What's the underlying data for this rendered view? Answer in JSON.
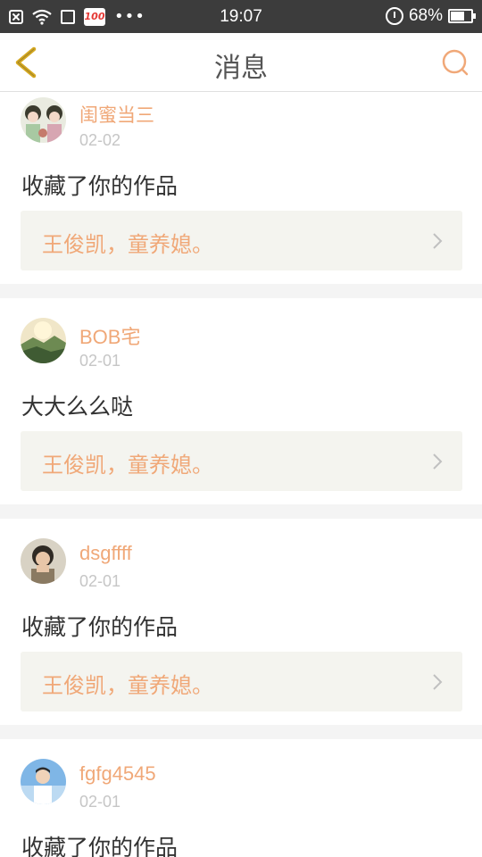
{
  "status_bar": {
    "time": "19:07",
    "battery_text": "68%",
    "battery_level": 0.68,
    "badge_text": "100",
    "more_dots": "•••"
  },
  "nav": {
    "title": "消息"
  },
  "messages": [
    {
      "username": "闺蜜当三",
      "date": "02-02",
      "content": "收藏了你的作品",
      "work_title": "王俊凯，童养媳。"
    },
    {
      "username": "BOB宅",
      "date": "02-01",
      "content": "大大么么哒",
      "work_title": "王俊凯，童养媳。"
    },
    {
      "username": "dsgffff",
      "date": "02-01",
      "content": "收藏了你的作品",
      "work_title": "王俊凯，童养媳。"
    },
    {
      "username": "fgfg4545",
      "date": "02-01",
      "content": "收藏了你的作品",
      "work_title": ""
    }
  ],
  "colors": {
    "accent": "#f0a878",
    "nav_back": "#d4a820",
    "status_bar_bg": "#3c3c3c"
  },
  "icons": {
    "back": "chevron-left-icon",
    "search": "search-icon",
    "work_arrow": "chevron-right-icon"
  }
}
